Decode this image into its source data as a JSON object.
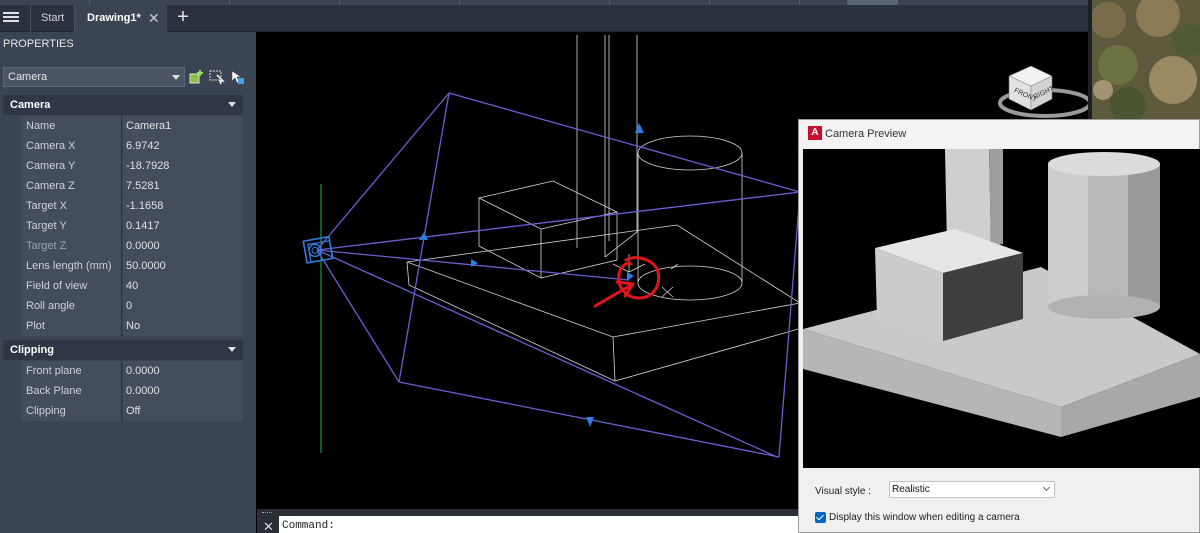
{
  "tabs": {
    "start": "Start",
    "drawing": "Drawing1*",
    "close_glyph": "✕",
    "add_glyph": "+"
  },
  "properties": {
    "title": "PROPERTIES",
    "object_type": "Camera",
    "sections": [
      {
        "header": "Camera",
        "rows": [
          {
            "name": "Name",
            "value": "Camera1"
          },
          {
            "name": "Camera X",
            "value": "6.9742"
          },
          {
            "name": "Camera Y",
            "value": "-18.7928"
          },
          {
            "name": "Camera Z",
            "value": "7.5281"
          },
          {
            "name": "Target X",
            "value": "-1.1658"
          },
          {
            "name": "Target Y",
            "value": "0.1417"
          },
          {
            "name": "Target Z",
            "value": "0.0000"
          },
          {
            "name": "Lens length (mm)",
            "value": "50.0000"
          },
          {
            "name": "Field of view",
            "value": "40"
          },
          {
            "name": "Roll angle",
            "value": "0"
          },
          {
            "name": "Plot",
            "value": "No"
          }
        ]
      },
      {
        "header": "Clipping",
        "rows": [
          {
            "name": "Front plane",
            "value": "0.0000"
          },
          {
            "name": "Back Plane",
            "value": "0.0000"
          },
          {
            "name": "Clipping",
            "value": "Off"
          }
        ]
      }
    ]
  },
  "viewcube": {
    "face_front": "FRONT",
    "face_right": "RIGHT"
  },
  "command": {
    "prompt": "Command:"
  },
  "camera_preview": {
    "title": "Camera Preview",
    "app_icon_letter": "A",
    "visual_style_label": "Visual style :",
    "visual_style_value": "Realistic",
    "display_checkbox_label": "Display this window when editing a camera",
    "display_checkbox_checked": true
  },
  "colors": {
    "panel_bg": "#3b4453",
    "camera_glyph": "#2f7de0",
    "frustum": "#6a5fd0",
    "annotation_red": "#e0151b",
    "axis_green": "#22b14c"
  }
}
